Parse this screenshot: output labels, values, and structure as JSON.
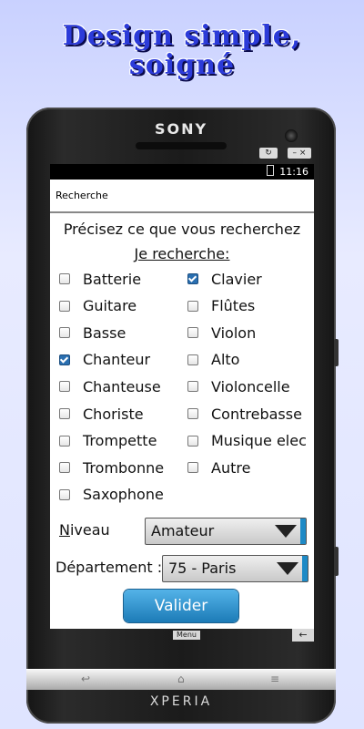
{
  "banner": {
    "line1": "Design simple,",
    "line2": "soigné"
  },
  "phone": {
    "brand": "SONY",
    "model": "XPERIA"
  },
  "status_bar": {
    "time": "11:16"
  },
  "screen": {
    "title": "Recherche",
    "question": "Précisez ce que vous recherchez",
    "subtitle": "Je recherche:",
    "instruments_left": [
      {
        "label": "Batterie",
        "checked": false
      },
      {
        "label": "Guitare",
        "checked": false
      },
      {
        "label": "Basse",
        "checked": false
      },
      {
        "label": "Chanteur",
        "checked": true
      },
      {
        "label": "Chanteuse",
        "checked": false
      },
      {
        "label": "Choriste",
        "checked": false
      },
      {
        "label": "Trompette",
        "checked": false
      },
      {
        "label": "Trombonne",
        "checked": false
      },
      {
        "label": "Saxophone",
        "checked": false
      }
    ],
    "instruments_right": [
      {
        "label": "Clavier",
        "checked": true
      },
      {
        "label": "Flûtes",
        "checked": false
      },
      {
        "label": "Violon",
        "checked": false
      },
      {
        "label": "Alto",
        "checked": false
      },
      {
        "label": "Violoncelle",
        "checked": false
      },
      {
        "label": "Contrebasse",
        "checked": false
      },
      {
        "label": "Musique elec",
        "checked": false
      },
      {
        "label": "Autre",
        "checked": false
      }
    ],
    "niveau": {
      "label": "Niveau",
      "value": "Amateur"
    },
    "departement": {
      "label": "Département :",
      "value": "75 - Paris"
    },
    "submit_label": "Valider"
  },
  "navbar": {
    "menu_label": "Menu"
  },
  "colors": {
    "accent": "#1e8ac6",
    "checkbox_checked": "#2a6fb0",
    "banner_text": "#2c3bd9"
  }
}
